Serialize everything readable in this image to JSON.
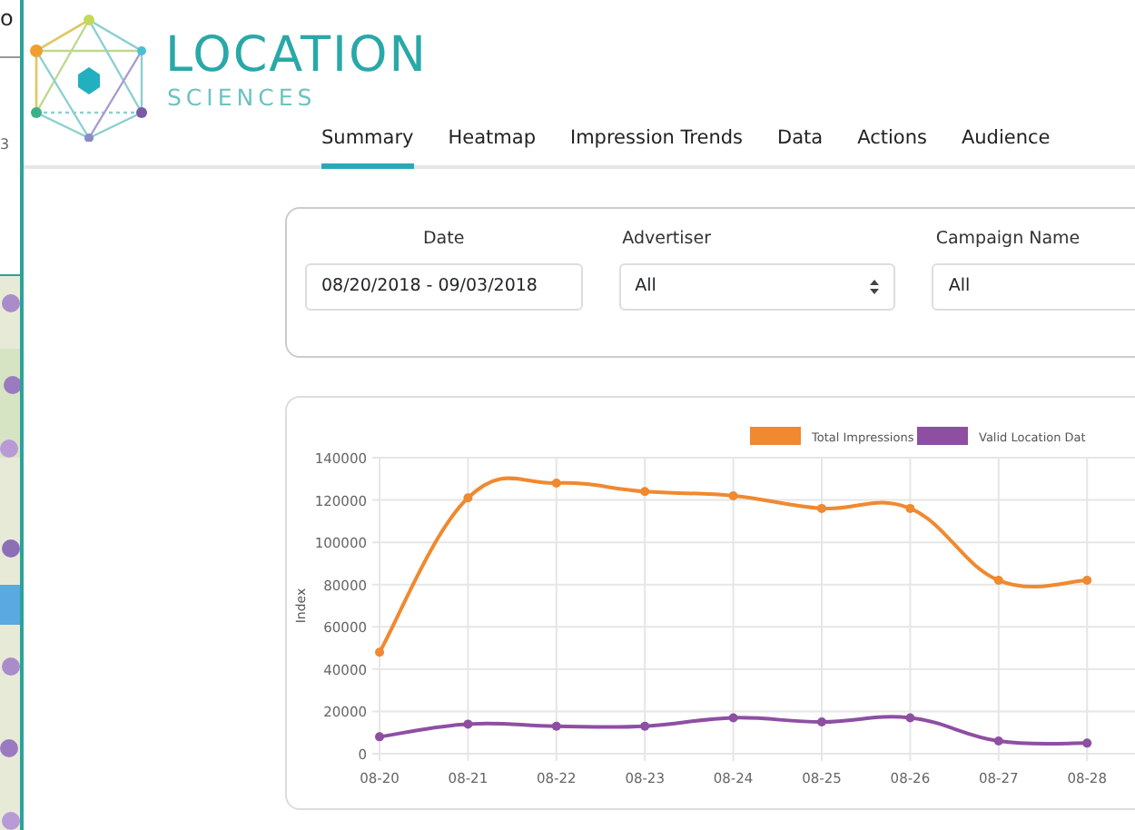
{
  "background_window": {
    "title_fragment": "o",
    "cell_fragment": "3"
  },
  "brand": {
    "name": "LOCATION",
    "subtitle": "SCIENCES"
  },
  "tabs": [
    {
      "label": "Summary",
      "selected": true
    },
    {
      "label": "Heatmap",
      "selected": false
    },
    {
      "label": "Impression Trends",
      "selected": false
    },
    {
      "label": "Data",
      "selected": false
    },
    {
      "label": "Actions",
      "selected": false
    },
    {
      "label": "Audience",
      "selected": false
    }
  ],
  "filters": [
    {
      "label": "Date",
      "kind": "text",
      "value": "08/20/2018 - 09/03/2018"
    },
    {
      "label": "Advertiser",
      "kind": "select",
      "value": "All"
    },
    {
      "label": "Campaign Name",
      "kind": "text",
      "value": "All"
    }
  ],
  "chart_data": {
    "type": "line",
    "grid": true,
    "legend": true,
    "ylabel": "Index",
    "categories": [
      "08-20",
      "08-21",
      "08-22",
      "08-23",
      "08-24",
      "08-25",
      "08-26",
      "08-27",
      "08-28"
    ],
    "ylim": [
      0,
      140000
    ],
    "yticks": [
      0,
      20000,
      40000,
      60000,
      80000,
      100000,
      120000,
      140000
    ],
    "series": [
      {
        "name": "Total Impressions",
        "color": "#f0892f",
        "marker": "circle",
        "values": [
          48000,
          121000,
          128000,
          124000,
          122000,
          116000,
          116000,
          82000,
          82000
        ]
      },
      {
        "name": "Valid Location Dat",
        "color": "#8e4fa3",
        "marker": "circle",
        "values": [
          8000,
          14000,
          13000,
          13000,
          17000,
          15000,
          17000,
          6000,
          5000
        ]
      }
    ]
  }
}
